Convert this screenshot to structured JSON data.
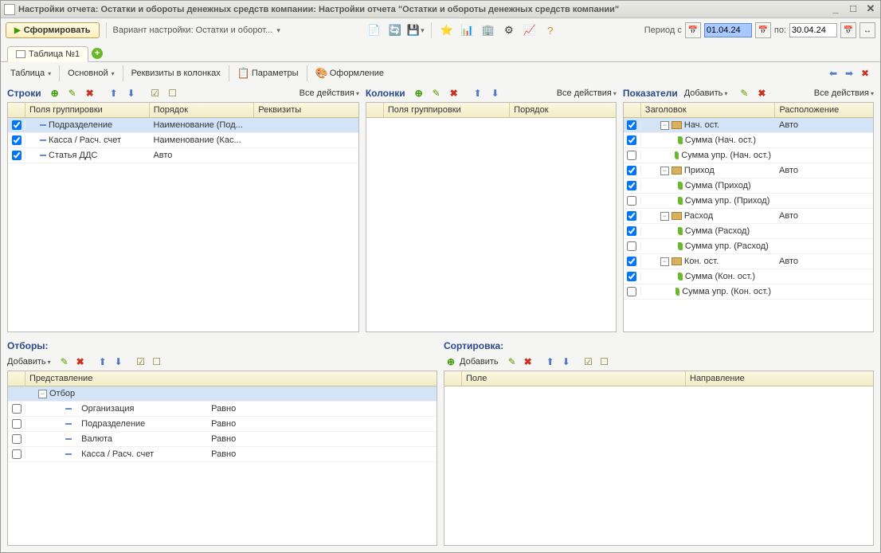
{
  "window_title": "Настройки отчета: Остатки и обороты денежных средств компании: Настройки отчета \"Остатки и обороты денежных средств компании\"",
  "toolbar": {
    "form_button": "Сформировать",
    "variant_label": "Вариант настройки: Остатки и оборот...",
    "period_from": "Период с",
    "period_to": "по:",
    "date_from": "01.04.24",
    "date_to": "30.04.24"
  },
  "tabs": {
    "tab1": "Таблица №1"
  },
  "subtoolbar": {
    "table": "Таблица",
    "main": "Основной",
    "cols_req": "Реквизиты в колонках",
    "params": "Параметры",
    "design": "Оформление"
  },
  "actions": {
    "all_actions": "Все действия",
    "add": "Добавить"
  },
  "rows_panel": {
    "title": "Строки",
    "header_group": "Поля группировки",
    "header_order": "Порядок",
    "header_req": "Реквизиты",
    "rows": [
      {
        "checked": true,
        "label": "Подразделение",
        "order": "Наименование (Под...",
        "req": ""
      },
      {
        "checked": true,
        "label": "Касса / Расч. счет",
        "order": "Наименование (Кас...",
        "req": ""
      },
      {
        "checked": true,
        "label": "Статья ДДС",
        "order": "Авто",
        "req": ""
      }
    ]
  },
  "cols_panel": {
    "title": "Колонки",
    "header_group": "Поля группировки",
    "header_order": "Порядок"
  },
  "indicators_panel": {
    "title": "Показатели",
    "header_title": "Заголовок",
    "header_loc": "Расположение",
    "items": [
      {
        "checked": true,
        "type": "folder",
        "label": "Нач. ост.",
        "loc": "Авто",
        "indent": 0,
        "expand": "minus"
      },
      {
        "checked": true,
        "type": "leaf",
        "label": "Сумма (Нач. ост.)",
        "loc": "",
        "indent": 1
      },
      {
        "checked": false,
        "type": "leaf",
        "label": "Сумма упр. (Нач. ост.)",
        "loc": "",
        "indent": 1
      },
      {
        "checked": true,
        "type": "folder",
        "label": "Приход",
        "loc": "Авто",
        "indent": 0,
        "expand": "minus"
      },
      {
        "checked": true,
        "type": "leaf",
        "label": "Сумма (Приход)",
        "loc": "",
        "indent": 1
      },
      {
        "checked": false,
        "type": "leaf",
        "label": "Сумма упр. (Приход)",
        "loc": "",
        "indent": 1
      },
      {
        "checked": true,
        "type": "folder",
        "label": "Расход",
        "loc": "Авто",
        "indent": 0,
        "expand": "minus"
      },
      {
        "checked": true,
        "type": "leaf",
        "label": "Сумма (Расход)",
        "loc": "",
        "indent": 1
      },
      {
        "checked": false,
        "type": "leaf",
        "label": "Сумма упр. (Расход)",
        "loc": "",
        "indent": 1
      },
      {
        "checked": true,
        "type": "folder",
        "label": "Кон. ост.",
        "loc": "Авто",
        "indent": 0,
        "expand": "minus"
      },
      {
        "checked": true,
        "type": "leaf",
        "label": "Сумма (Кон. ост.)",
        "loc": "",
        "indent": 1
      },
      {
        "checked": false,
        "type": "leaf",
        "label": "Сумма упр. (Кон. ост.)",
        "loc": "",
        "indent": 1
      }
    ]
  },
  "filters_panel": {
    "title": "Отборы:",
    "header_rep": "Представление",
    "root": "Отбор",
    "items": [
      {
        "checked": false,
        "label": "Организация",
        "cond": "Равно"
      },
      {
        "checked": false,
        "label": "Подразделение",
        "cond": "Равно"
      },
      {
        "checked": false,
        "label": "Валюта",
        "cond": "Равно"
      },
      {
        "checked": false,
        "label": "Касса / Расч. счет",
        "cond": "Равно"
      }
    ]
  },
  "sort_panel": {
    "title": "Сортировка:",
    "header_field": "Поле",
    "header_dir": "Направление"
  }
}
